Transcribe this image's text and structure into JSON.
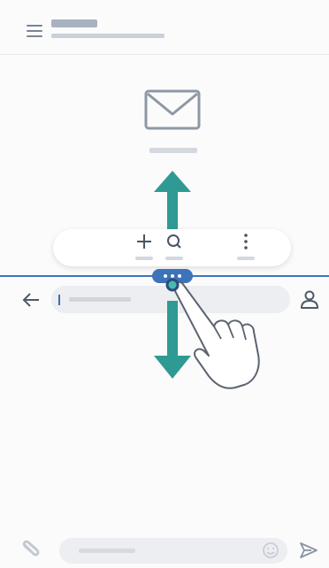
{
  "top_app": {
    "header": {
      "menu_icon": "hamburger-menu-icon",
      "title": "",
      "subtitle": ""
    },
    "empty_state": {
      "icon": "mail-envelope-icon",
      "label": ""
    },
    "toolbar": {
      "items": [
        {
          "icon": "plus-icon",
          "label": ""
        },
        {
          "icon": "search-icon",
          "label": ""
        },
        {
          "icon": "more-vertical-icon",
          "label": ""
        }
      ]
    }
  },
  "split_divider": {
    "handle_icon": "drag-handle-dots-icon",
    "accent_color": "#3d73b8"
  },
  "gesture": {
    "hand_icon": "hand-drag-icon",
    "arrow_up_icon": "arrow-up-icon",
    "arrow_down_icon": "arrow-down-icon",
    "arrow_color": "#2e9a93"
  },
  "bottom_app": {
    "back_icon": "back-arrow-icon",
    "search": {
      "placeholder": ""
    },
    "contact_icon": "person-icon",
    "compose": {
      "attach_icon": "paperclip-icon",
      "placeholder": "",
      "emoji_icon": "emoji-icon",
      "send_icon": "send-icon"
    }
  }
}
